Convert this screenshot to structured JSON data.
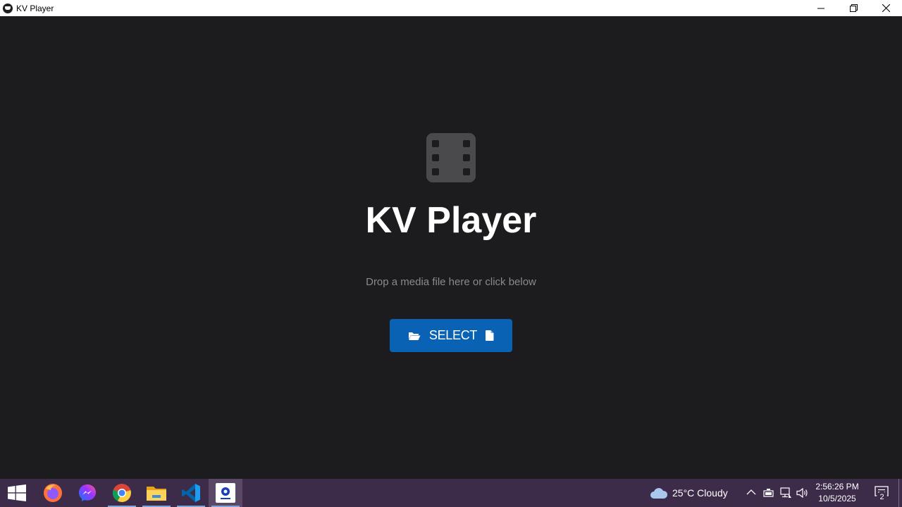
{
  "window": {
    "title": "KV Player"
  },
  "main": {
    "app_title": "KV Player",
    "subtitle": "Drop a media file here or click below",
    "select_label": "SELECT",
    "accent_color": "#0a62b5"
  },
  "taskbar": {
    "apps": [
      "start-icon",
      "firefox-icon",
      "messenger-icon",
      "chrome-icon",
      "file-explorer-icon",
      "vscode-icon",
      "kv-player-icon"
    ],
    "weather": "25°C  Cloudy",
    "time": "2:56:26 PM",
    "date": "10/5/2025",
    "notification_count": "2"
  }
}
